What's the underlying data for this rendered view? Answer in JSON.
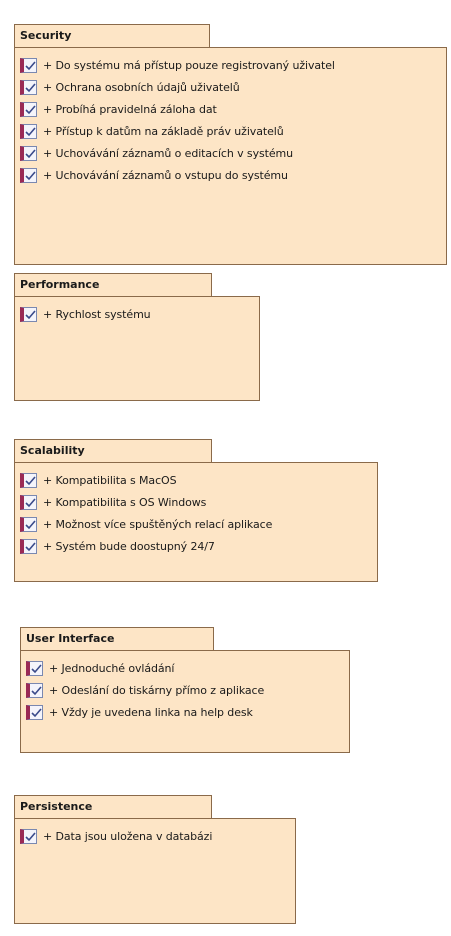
{
  "packages": [
    {
      "title": "Security",
      "items": [
        "+ Do systému má přístup pouze registrovaný uživatel",
        "+ Ochrana osobních údajů uživatelů",
        "+ Probíhá pravidelná záloha dat",
        "+ Přístup k datům na základě práv uživatelů",
        "+ Uchovávání záznamů o editacích v systému",
        "+ Uchovávání záznamů o vstupu do systému"
      ]
    },
    {
      "title": "Performance",
      "items": [
        "+ Rychlost systému"
      ]
    },
    {
      "title": "Scalability",
      "items": [
        "+ Kompatibilita s MacOS",
        "+ Kompatibilita s OS Windows",
        "+ Možnost více spuštěných relací aplikace",
        "+ Systém bude doostupný 24/7"
      ]
    },
    {
      "title": "User Interface",
      "items": [
        "+ Jednoduché ovládání",
        "+ Odeslání do tiskárny přímo z aplikace",
        "+ Vždy je uvedena linka na help desk"
      ]
    },
    {
      "title": "Persistence",
      "items": [
        "+ Data jsou uložena v databázi"
      ]
    }
  ],
  "icons": {
    "item": "requirement-checkbox-icon"
  },
  "colors": {
    "package_fill": "#fde5c6",
    "package_border": "#8a6a4a",
    "checkbox_stripe": "#9a2a55"
  }
}
